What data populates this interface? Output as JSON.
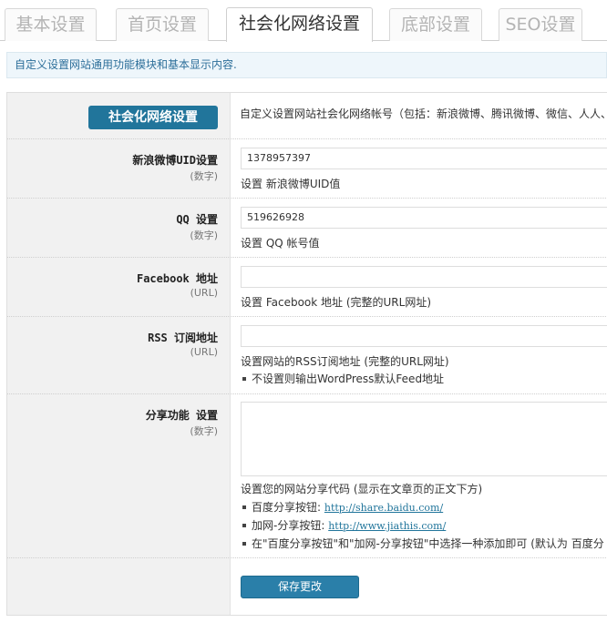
{
  "tabs": [
    {
      "label": "基本设置"
    },
    {
      "label": "首页设置"
    },
    {
      "label": "社会化网络设置"
    },
    {
      "label": "底部设置"
    },
    {
      "label": "SEO设置"
    }
  ],
  "notice": "自定义设置网站通用功能模块和基本显示内容.",
  "section": {
    "button_label": "社会化网络设置",
    "description": "自定义设置网站社会化网络帐号（包括：新浪微博、腾讯微博、微信、人人、"
  },
  "fields": {
    "weibo": {
      "label": "新浪微博UID设置",
      "sub": "(数字)",
      "value": "1378957397",
      "desc": "设置 新浪微博UID值"
    },
    "qq": {
      "label": "QQ 设置",
      "sub": "(数字)",
      "value": "519626928",
      "desc": "设置 QQ 帐号值"
    },
    "facebook": {
      "label": "Facebook 地址",
      "sub": "(URL)",
      "value": "",
      "desc": "设置 Facebook 地址 (完整的URL网址)"
    },
    "rss": {
      "label": "RSS 订阅地址",
      "sub": "(URL)",
      "value": "",
      "desc": "设置网站的RSS订阅地址 (完整的URL网址)",
      "bullet": "不设置则输出WordPress默认Feed地址"
    },
    "share": {
      "label": "分享功能 设置",
      "sub": "(数字)",
      "desc": "设置您的网站分享代码 (显示在文章页的正文下方)",
      "bullet1_text": "百度分享按钮:",
      "bullet1_link": "http://share.baidu.com/",
      "bullet2_text": "加网-分享按钮:",
      "bullet2_link": "http://www.jiathis.com/",
      "bullet3_text": "在\"百度分享按钮\"和\"加网-分享按钮\"中选择一种添加即可 (默认为 百度分"
    }
  },
  "save_label": "保存更改"
}
